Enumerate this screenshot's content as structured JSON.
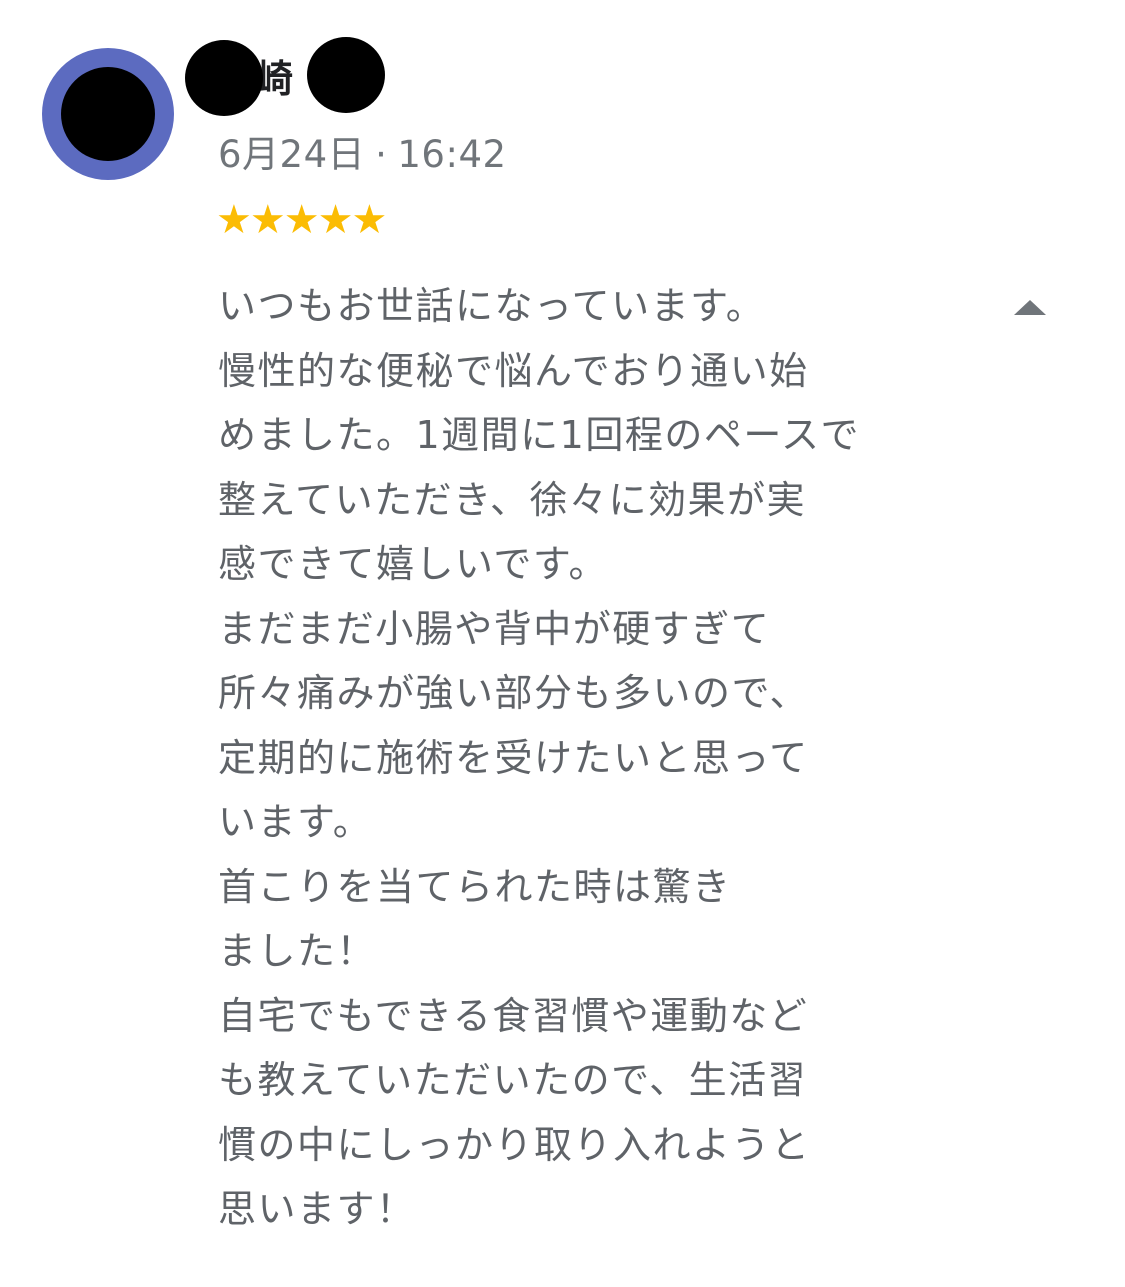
{
  "reviewer": {
    "name_visible": "崎",
    "date": "6月24日",
    "separator": "·",
    "time": "16:42",
    "avatar_color": "#5c6bc0"
  },
  "rating": {
    "stars": 5,
    "max": 5,
    "display": "★★★★★",
    "color": "#fbbc04"
  },
  "review": {
    "lines": [
      "いつもお世話になっています。",
      "慢性的な便秘で悩んでおり通い始",
      "めました。1週間に1回程のペースで",
      "整えていただき、徐々に効果が実",
      "感できて嬉しいです。",
      "まだまだ小腸や背中が硬すぎて",
      "所々痛みが強い部分も多いので、",
      "定期的に施術を受けたいと思って",
      "います。",
      "首こりを当てられた時は驚き",
      "ました！",
      "自宅でもできる食習慣や運動など",
      "も教えていただいたので、生活習",
      "慣の中にしっかり取り入れようと",
      "思います！"
    ]
  },
  "controls": {
    "collapse_icon": "triangle-up-icon"
  }
}
